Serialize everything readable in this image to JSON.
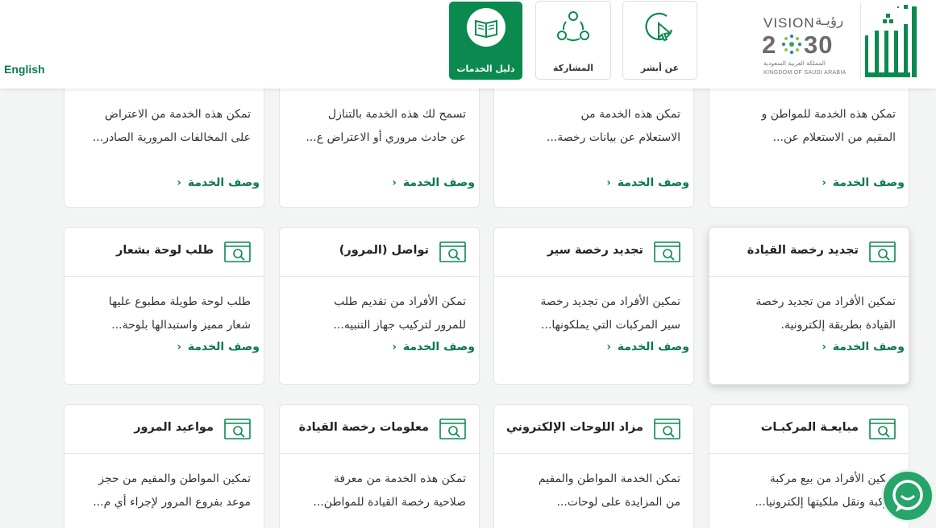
{
  "header": {
    "language_link": "English",
    "nav": [
      {
        "label": "دليل الخدمات",
        "icon": "book-icon",
        "active": true
      },
      {
        "label": "المشاركة",
        "icon": "share-network-icon",
        "active": false
      },
      {
        "label": "عن أبشر",
        "icon": "cursor-click-icon",
        "active": false
      }
    ],
    "vision": {
      "title": "VISION",
      "arabic_title": "رؤيـة",
      "year_left": "2",
      "year_right": "30",
      "subtitle_ar": "المملكة العربية السعودية",
      "subtitle_en": "KINGDOM OF SAUDI ARABIA"
    },
    "brand_logo": "absher-logo"
  },
  "top_row": [
    {
      "desc_line1": "تمكن هذه الخدمة للمواطن و",
      "desc_line2": "المقيم من الاستعلام عن...",
      "link": "وصف الخدمة"
    },
    {
      "desc_line1": "تمكن هذه الخدمة من",
      "desc_line2": "الاستعلام عن بيانات رخصة...",
      "link": "وصف الخدمة"
    },
    {
      "desc_line1": "تسمح لك هذه الخدمة بالتنازل",
      "desc_line2": "عن حادث مروري أو الاعتراض ع...",
      "link": "وصف الخدمة"
    },
    {
      "desc_line1": "تمكن هذه الخدمة من الاعتراض",
      "desc_line2": "على المخالفات المرورية الصادر...",
      "link": "وصف الخدمة"
    }
  ],
  "mid_row": [
    {
      "title": "تجديد رخصة القيادة",
      "desc_line1": "تمكين الأفراد من تجديد رخصة",
      "desc_line2": "القيادة بطريقة إلكترونية.",
      "link": "وصف الخدمة"
    },
    {
      "title": "تجديد رخصة سير",
      "desc_line1": "تمكين الأفراد من تجديد رخصة",
      "desc_line2": "سير المركبات التي يملكونها...",
      "link": "وصف الخدمة"
    },
    {
      "title": "تواصل (المرور)",
      "desc_line1": "تمكن الأفراد من تقديم طلب",
      "desc_line2": "للمرور لتركيب جهاز التنبيه...",
      "link": "وصف الخدمة"
    },
    {
      "title": "طلب لوحة بشعار",
      "desc_line1": "طلب لوحة طويلة مطبوع عليها",
      "desc_line2": "شعار مميز واستبدالها بلوحة...",
      "link": "وصف الخدمة"
    }
  ],
  "bot_row": [
    {
      "title": "مبايعـة المركبـات",
      "desc_line1": "تمكين الأفراد من بيع مركبة",
      "desc_line2": "مركبة ونقل ملكيتها إلكترونيا..."
    },
    {
      "title": "مزاد اللوحات الإلكتروني",
      "desc_line1": "تمكن الخدمة المواطن والمقيم",
      "desc_line2": "من المزايدة على لوحات..."
    },
    {
      "title": "معلومات رخصة القيادة",
      "desc_line1": "تمكن هذه الخدمة من معرفة",
      "desc_line2": "صلاحية رخصة القيادة للمواطن..."
    },
    {
      "title": "مواعيد المرور",
      "desc_line1": "تمكين المواطن والمقيم من حجز",
      "desc_line2": "موعد بفروع المرور لإجراء أي م..."
    }
  ],
  "chat": {
    "icon": "chat-support-icon"
  },
  "colors": {
    "brand_green": "#0a8a4f",
    "link_green": "#0a7b4a",
    "chat_green": "#27a469"
  }
}
